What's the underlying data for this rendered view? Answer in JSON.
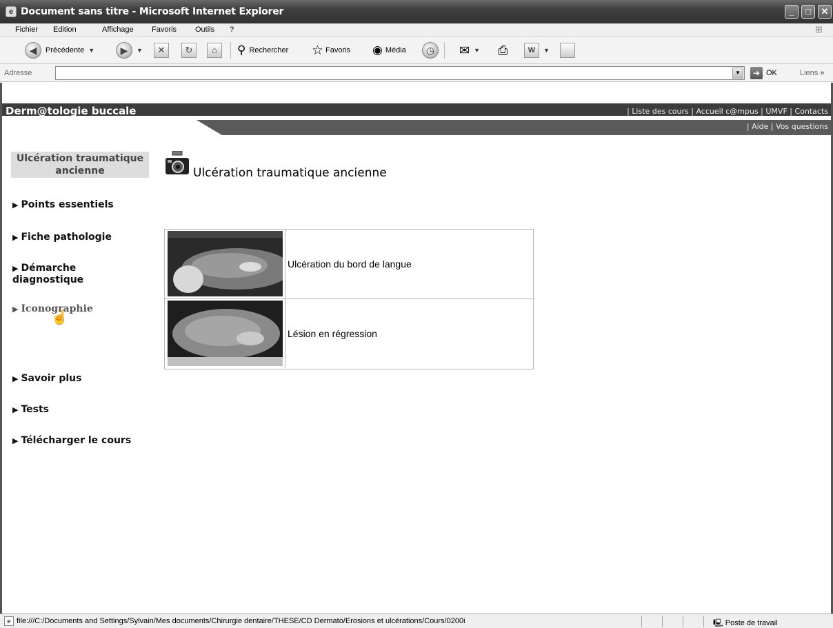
{
  "window": {
    "title": "Document sans titre - Microsoft Internet Explorer"
  },
  "menu": [
    "Fichier",
    "Edition",
    "Affichage",
    "Favoris",
    "Outils",
    "?"
  ],
  "toolbar": {
    "back_label": "Précédente",
    "search_label": "Rechercher",
    "favorites_label": "Favoris",
    "media_label": "Média"
  },
  "address": {
    "label": "Adresse",
    "value": "",
    "go_label": "OK",
    "links_label": "Liens"
  },
  "site": {
    "title": "Derm@tologie buccale",
    "top_links": "| Liste des cours | Accueil c@mpus | UMVF | Contacts",
    "top_links2": "| Aide | Vos questions"
  },
  "nav": {
    "current": "Ulcération traumatique ancienne",
    "items": [
      "Points essentiels",
      "Fiche pathologie",
      "Démarche diagnostique",
      "Iconographie",
      "Savoir plus",
      "Tests",
      "Télécharger le cours"
    ]
  },
  "main": {
    "heading": "Ulcération traumatique ancienne",
    "images": [
      {
        "caption": "Ulcération du bord de langue"
      },
      {
        "caption": "Lésion en régression"
      }
    ]
  },
  "status": {
    "url": "file:///C:/Documents and Settings/Sylvain/Mes documents/Chirurgie dentaire/THESE/CD Dermato/Erosions et ulcérations/Cours/0200i",
    "zone": "Poste de travail"
  }
}
